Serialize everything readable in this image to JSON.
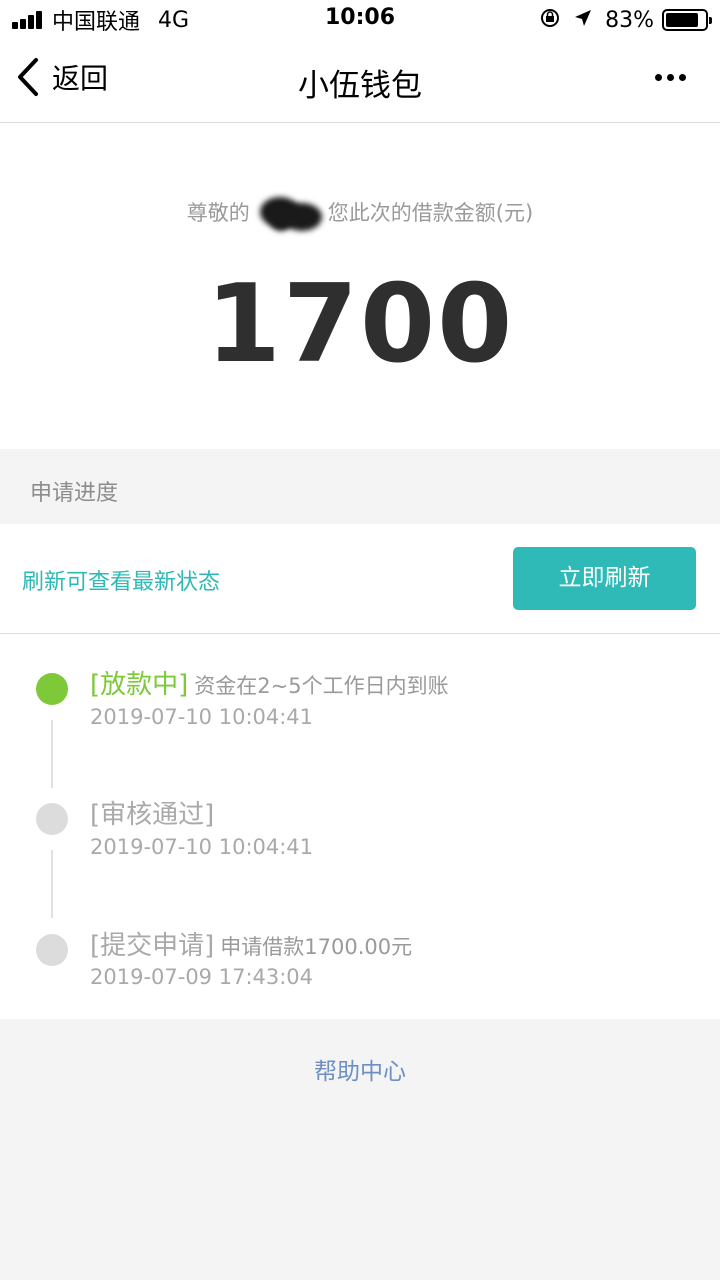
{
  "status_bar": {
    "carrier": "中国联通",
    "network": "4G",
    "time": "10:06",
    "battery_percent": "83%",
    "battery_level": 0.83,
    "icons": [
      "signal-icon",
      "rotation-lock-icon",
      "location-arrow-icon",
      "battery-icon"
    ]
  },
  "nav": {
    "back_label": "返回",
    "title": "小伍钱包"
  },
  "loan": {
    "greeting_prefix": "尊敬的",
    "greeting_suffix": "您此次的借款金额(元)",
    "amount": "1700"
  },
  "progress": {
    "section_label": "申请进度",
    "refresh_hint": "刷新可查看最新状态",
    "refresh_button": "立即刷新"
  },
  "timeline": [
    {
      "status": "[放款中]",
      "desc": "资金在2~5个工作日内到账",
      "time": "2019-07-10 10:04:41",
      "active": true
    },
    {
      "status": "[审核通过]",
      "desc": "",
      "time": "2019-07-10 10:04:41",
      "active": false
    },
    {
      "status": "[提交申请]",
      "desc": "申请借款1700.00元",
      "time": "2019-07-09 17:43:04",
      "active": false
    }
  ],
  "footer": {
    "help_center": "帮助中心"
  },
  "colors": {
    "accent": "#2fbab7",
    "active_green": "#7dc93a",
    "link_blue": "#6d8fc4"
  }
}
